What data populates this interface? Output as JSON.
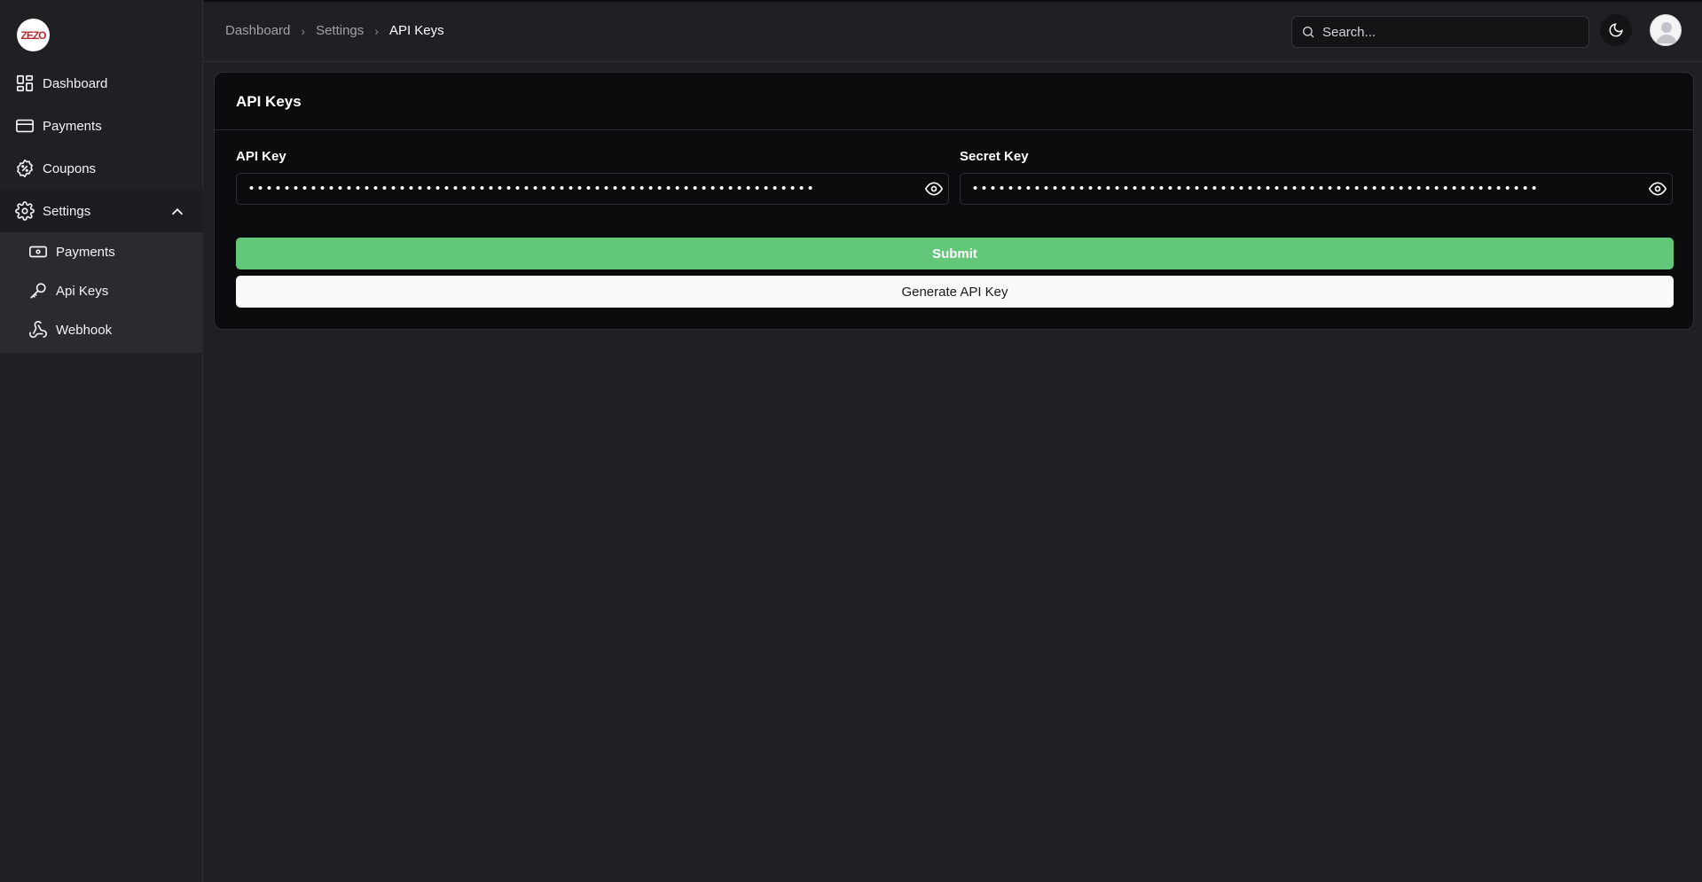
{
  "brand": {
    "logo_text": "ZEZO"
  },
  "sidebar": {
    "items": [
      {
        "label": "Dashboard",
        "icon": "dashboard-grid-icon"
      },
      {
        "label": "Payments",
        "icon": "credit-card-icon"
      },
      {
        "label": "Coupons",
        "icon": "discount-badge-icon"
      },
      {
        "label": "Settings",
        "icon": "gear-icon",
        "expanded": true
      }
    ],
    "settings_submenu": [
      {
        "label": "Payments",
        "icon": "banknote-icon"
      },
      {
        "label": "Api Keys",
        "icon": "key-icon"
      },
      {
        "label": "Webhook",
        "icon": "webhook-icon"
      }
    ]
  },
  "header": {
    "breadcrumb": [
      "Dashboard",
      "Settings",
      "API Keys"
    ],
    "search_placeholder": "Search...",
    "theme_icon": "moon-icon"
  },
  "card": {
    "title": "API Keys",
    "api_key": {
      "label": "API Key",
      "value": "••••••••••••••••••••••••••••••••••••••••••••••••••••••••••••••••"
    },
    "secret_key": {
      "label": "Secret Key",
      "value": "••••••••••••••••••••••••••••••••••••••••••••••••••••••••••••••••"
    },
    "submit_label": "Submit",
    "generate_label": "Generate API Key"
  },
  "colors": {
    "background": "#1f1f24",
    "card": "#0c0c0e",
    "submit": "#63c77a",
    "generate": "#fafafa",
    "logo_accent": "#b3272f"
  }
}
